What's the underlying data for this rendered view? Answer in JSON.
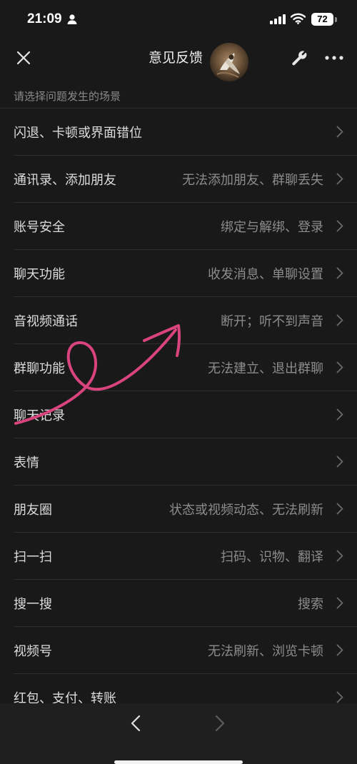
{
  "status_bar": {
    "time": "21:09",
    "battery": "72"
  },
  "header": {
    "title": "意见反馈"
  },
  "section_hint": "请选择问题发生的场景",
  "items": [
    {
      "title": "闪退、卡顿或界面错位",
      "desc": ""
    },
    {
      "title": "通讯录、添加朋友",
      "desc": "无法添加朋友、群聊丢失"
    },
    {
      "title": "账号安全",
      "desc": "绑定与解绑、登录"
    },
    {
      "title": "聊天功能",
      "desc": "收发消息、单聊设置"
    },
    {
      "title": "音视频通话",
      "desc": "断开；听不到声音"
    },
    {
      "title": "群聊功能",
      "desc": "无法建立、退出群聊"
    },
    {
      "title": "聊天记录",
      "desc": ""
    },
    {
      "title": "表情",
      "desc": ""
    },
    {
      "title": "朋友圈",
      "desc": "状态或视频动态、无法刷新"
    },
    {
      "title": "扫一扫",
      "desc": "扫码、识物、翻译"
    },
    {
      "title": "搜一搜",
      "desc": "搜索"
    },
    {
      "title": "视频号",
      "desc": "无法刷新、浏览卡顿"
    },
    {
      "title": "红包、支付、转账",
      "desc": ""
    }
  ],
  "colors": {
    "background": "#191919",
    "annotation_stroke": "#d9447e"
  }
}
